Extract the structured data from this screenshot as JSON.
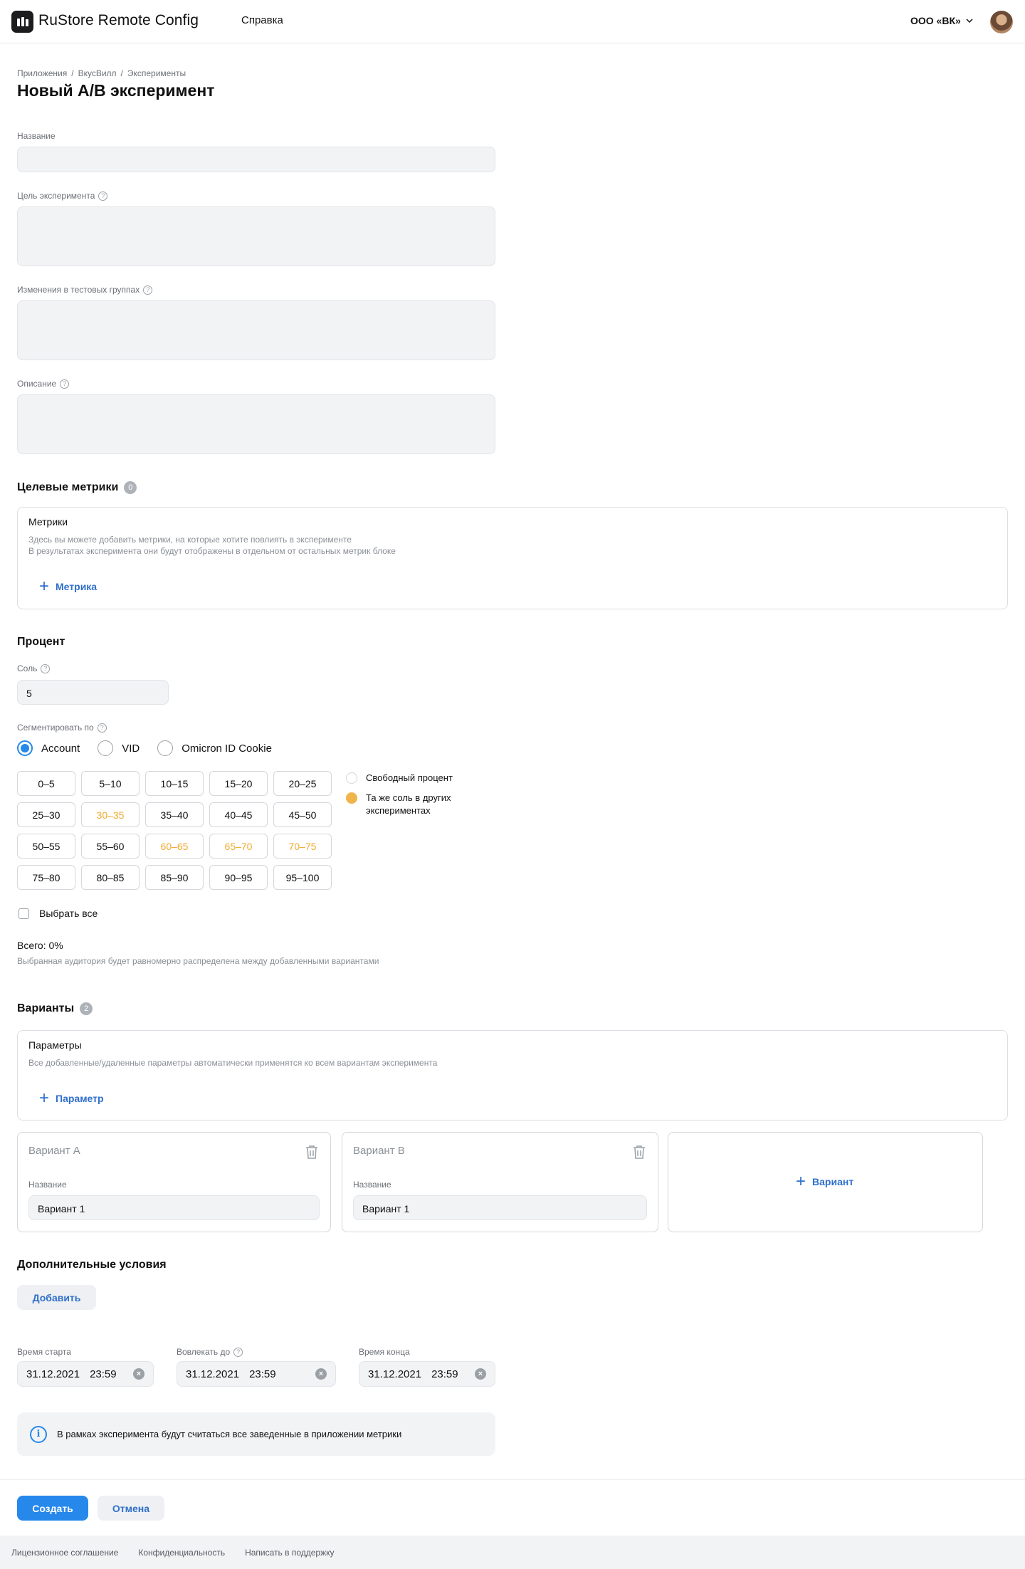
{
  "header": {
    "brand": "RuStore Remote Config",
    "help": "Справка",
    "org": "ООО «ВК»"
  },
  "breadcrumb": [
    "Приложения",
    "ВкусВилл",
    "Эксперименты"
  ],
  "page_title": "Новый A/B эксперимент",
  "fields": {
    "name_label": "Название",
    "goal_label": "Цель эксперимента",
    "changes_label": "Изменения в тестовых группах",
    "description_label": "Описание"
  },
  "metrics": {
    "title": "Целевые метрики",
    "count": "0",
    "card_title": "Метрики",
    "desc_line1": "Здесь вы можете добавить метрики, на которые хотите повлиять в эксперименте",
    "desc_line2": "В результатах эксперимента они будут отображены в отдельном от остальных метрик блоке",
    "add_label": "Метрика"
  },
  "percent": {
    "title": "Процент",
    "salt_label": "Соль",
    "salt_value": "5",
    "segment_label": "Сегментировать по",
    "segment_options": [
      "Account",
      "VID",
      "Omicron ID Cookie"
    ],
    "segment_selected": "Account",
    "ranges": [
      "0–5",
      "5–10",
      "10–15",
      "15–20",
      "20–25",
      "25–30",
      "30–35",
      "35–40",
      "40–45",
      "45–50",
      "50–55",
      "55–60",
      "60–65",
      "65–70",
      "70–75",
      "75–80",
      "80–85",
      "85–90",
      "90–95",
      "95–100"
    ],
    "same_salt_ranges": [
      "30–35",
      "60–65",
      "65–70",
      "70–75"
    ],
    "legend_free": "Свободный процент",
    "legend_same": "Та же соль в других экспериментах",
    "select_all": "Выбрать все",
    "total": "Всего: 0%",
    "total_hint": "Выбранная аудитория будет равномерно распределена между добавленными вариантами",
    "same_color": "#f0a92e"
  },
  "variants": {
    "title": "Варианты",
    "count": "2",
    "params_title": "Параметры",
    "params_desc": "Все добавленные/удаленные параметры автоматически применятся ко всем вариантам эксперимента",
    "add_param": "Параметр",
    "items": [
      {
        "title": "Вариант A",
        "name_label": "Название",
        "name_value": "Вариант 1"
      },
      {
        "title": "Вариант B",
        "name_label": "Название",
        "name_value": "Вариант 1"
      }
    ],
    "add_variant": "Вариант"
  },
  "conditions": {
    "title": "Дополнительные условия",
    "add_button": "Добавить"
  },
  "dates": {
    "start_label": "Время старта",
    "start_date": "31.12.2021",
    "start_time": "23:59",
    "engage_label": "Вовлекать до",
    "engage_date": "31.12.2021",
    "engage_time": "23:59",
    "end_label": "Время конца",
    "end_date": "31.12.2021",
    "end_time": "23:59"
  },
  "info_text": "В рамках эксперимента будут считаться все заведенные в приложении метрики",
  "actions": {
    "create": "Создать",
    "cancel": "Отмена"
  },
  "footer": [
    "Лицензионное соглашение",
    "Конфиденциальность",
    "Написать в поддержку"
  ],
  "colors": {
    "accent": "#2688eb",
    "link": "#2f6fcb"
  }
}
